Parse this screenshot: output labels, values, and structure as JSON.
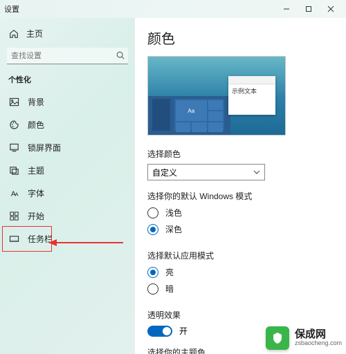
{
  "window": {
    "title": "设置"
  },
  "sidebar": {
    "home": "主页",
    "search_placeholder": "查找设置",
    "section": "个性化",
    "items": [
      {
        "label": "背景"
      },
      {
        "label": "颜色"
      },
      {
        "label": "锁屏界面"
      },
      {
        "label": "主题"
      },
      {
        "label": "字体"
      },
      {
        "label": "开始"
      },
      {
        "label": "任务栏"
      }
    ]
  },
  "main": {
    "title": "颜色",
    "preview_sample_text": "示例文本",
    "preview_tile_label": "Aa",
    "choose_color_label": "选择颜色",
    "choose_color_value": "自定义",
    "windows_mode_label": "选择你的默认 Windows 模式",
    "windows_mode_options": {
      "light": "浅色",
      "dark": "深色"
    },
    "windows_mode_selected": "dark",
    "app_mode_label": "选择默认应用模式",
    "app_mode_options": {
      "light": "亮",
      "dark": "暗"
    },
    "app_mode_selected": "light",
    "transparency_label": "透明效果",
    "transparency_value": "开",
    "accent_label": "选择你的主题色"
  },
  "watermark": {
    "cn": "保成网",
    "en": "zsbaocheng.com"
  }
}
